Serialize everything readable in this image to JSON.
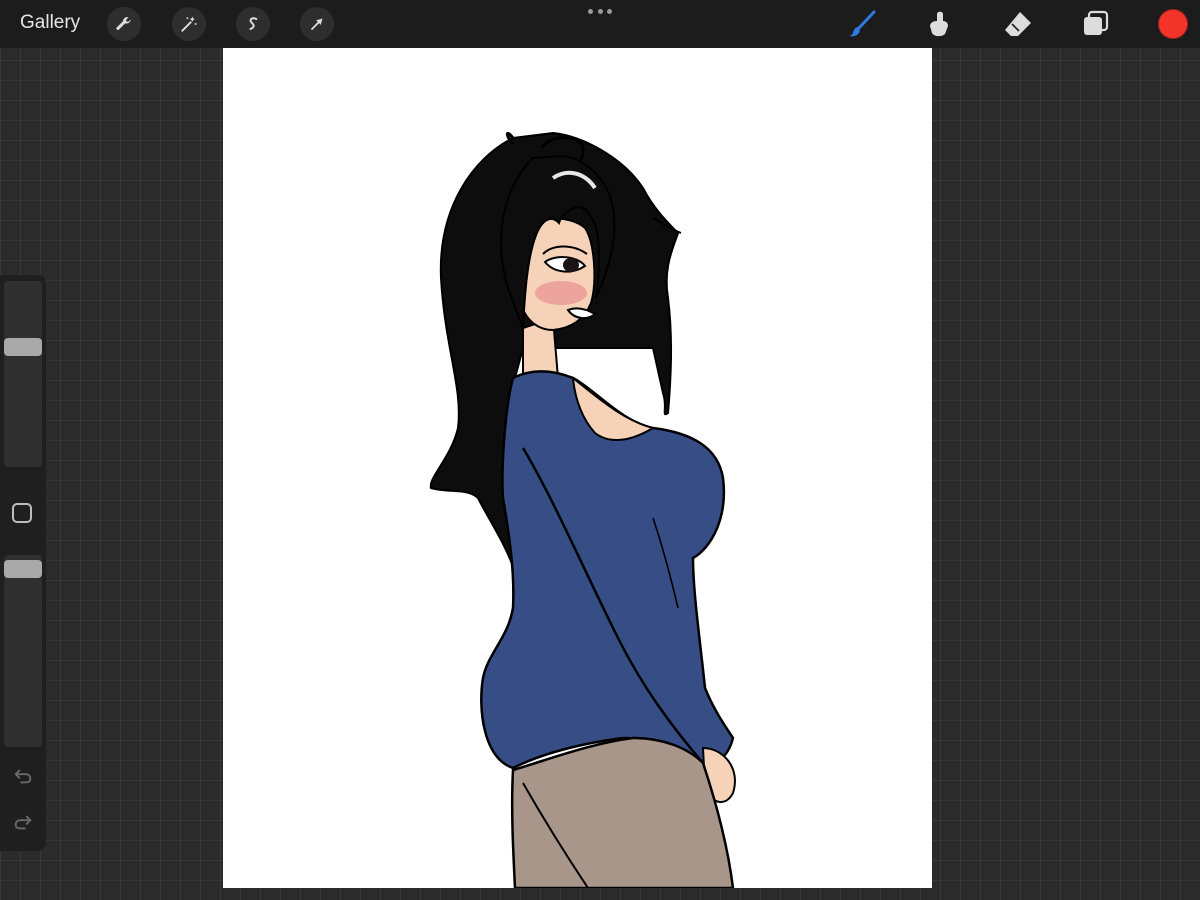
{
  "topbar": {
    "gallery_label": "Gallery",
    "left_tools": [
      "wrench-icon",
      "magic-wand-icon",
      "selection-icon",
      "transform-arrow-icon"
    ],
    "right_tools": [
      "brush-icon",
      "smudge-icon",
      "eraser-icon",
      "layers-icon"
    ],
    "active_tool": "brush-icon",
    "current_color": "#f2342a"
  },
  "sidebar": {
    "brush_size_level": 0.66,
    "opacity_level": 0.97,
    "icons": [
      "modify-square-icon",
      "undo-icon",
      "redo-icon"
    ]
  },
  "colors": {
    "accent_blue": "#2d7be0",
    "sweater": "#364d86",
    "hair": "#0d0d0d",
    "skin": "#f6d3b8",
    "pants": "#a9968a"
  }
}
